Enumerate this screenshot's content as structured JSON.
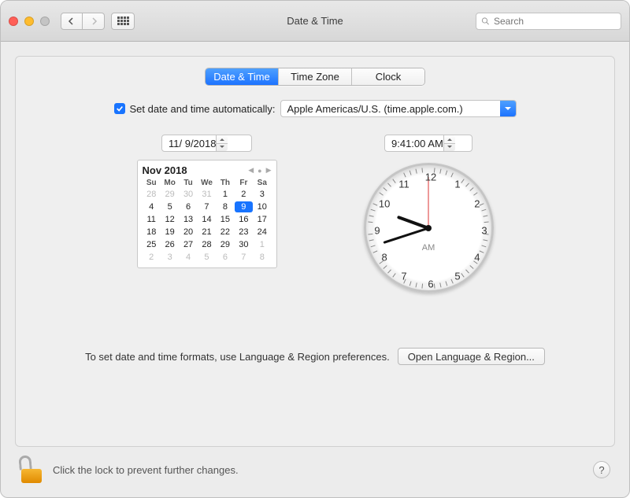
{
  "window": {
    "title": "Date & Time"
  },
  "toolbar": {
    "search_placeholder": "Search"
  },
  "tabs": {
    "date_time": "Date & Time",
    "time_zone": "Time Zone",
    "clock": "Clock"
  },
  "auto": {
    "label": "Set date and time automatically:",
    "server": "Apple Americas/U.S. (time.apple.com.)",
    "checked": true
  },
  "date_field": "11/  9/2018",
  "time_field": "9:41:00 AM",
  "calendar": {
    "month_year": "Nov 2018",
    "day_headers": [
      "Su",
      "Mo",
      "Tu",
      "We",
      "Th",
      "Fr",
      "Sa"
    ],
    "weeks": [
      [
        {
          "n": "28",
          "o": true
        },
        {
          "n": "29",
          "o": true
        },
        {
          "n": "30",
          "o": true
        },
        {
          "n": "31",
          "o": true
        },
        {
          "n": "1"
        },
        {
          "n": "2"
        },
        {
          "n": "3"
        }
      ],
      [
        {
          "n": "4"
        },
        {
          "n": "5"
        },
        {
          "n": "6"
        },
        {
          "n": "7"
        },
        {
          "n": "8"
        },
        {
          "n": "9",
          "sel": true
        },
        {
          "n": "10"
        }
      ],
      [
        {
          "n": "11"
        },
        {
          "n": "12"
        },
        {
          "n": "13"
        },
        {
          "n": "14"
        },
        {
          "n": "15"
        },
        {
          "n": "16"
        },
        {
          "n": "17"
        }
      ],
      [
        {
          "n": "18"
        },
        {
          "n": "19"
        },
        {
          "n": "20"
        },
        {
          "n": "21"
        },
        {
          "n": "22"
        },
        {
          "n": "23"
        },
        {
          "n": "24"
        }
      ],
      [
        {
          "n": "25"
        },
        {
          "n": "26"
        },
        {
          "n": "27"
        },
        {
          "n": "28"
        },
        {
          "n": "29"
        },
        {
          "n": "30"
        },
        {
          "n": "1",
          "o": true
        }
      ],
      [
        {
          "n": "2",
          "o": true
        },
        {
          "n": "3",
          "o": true
        },
        {
          "n": "4",
          "o": true
        },
        {
          "n": "5",
          "o": true
        },
        {
          "n": "6",
          "o": true
        },
        {
          "n": "7",
          "o": true
        },
        {
          "n": "8",
          "o": true
        }
      ]
    ]
  },
  "clock": {
    "numbers": [
      "12",
      "1",
      "2",
      "3",
      "4",
      "5",
      "6",
      "7",
      "8",
      "9",
      "10",
      "11"
    ],
    "ampm": "AM"
  },
  "hint": {
    "text": "To set date and time formats, use Language & Region preferences.",
    "button": "Open Language & Region..."
  },
  "lock": {
    "text": "Click the lock to prevent further changes."
  },
  "help": "?"
}
